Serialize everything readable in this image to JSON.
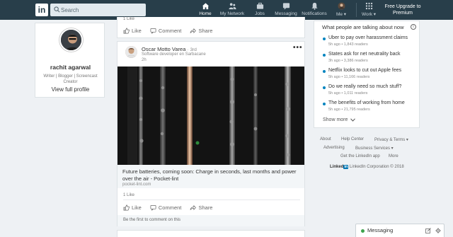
{
  "nav": {
    "logo": "in",
    "search_placeholder": "Search",
    "items": [
      {
        "label": "Home",
        "icon": "home-icon"
      },
      {
        "label": "My Network",
        "icon": "network-icon"
      },
      {
        "label": "Jobs",
        "icon": "briefcase-icon"
      },
      {
        "label": "Messaging",
        "icon": "chat-icon"
      },
      {
        "label": "Notifications",
        "icon": "bell-icon"
      },
      {
        "label": "Me ▾",
        "icon": "avatar"
      },
      {
        "label": "Work ▾",
        "icon": "grid-icon"
      }
    ],
    "premium": "Free Upgrade to Premium"
  },
  "profile": {
    "name": "rachit agarwal",
    "headline": "Writer | Blogger | Screencast Creator",
    "view_profile": "View full profile"
  },
  "feed_top": {
    "count": "1 Like",
    "actions": [
      "Like",
      "Comment",
      "Share"
    ]
  },
  "post": {
    "author": "Oscar Motto Varea",
    "degree": "· 3rd",
    "author_title": "Software developer en Sarbacane",
    "time": "2h",
    "more": "•••",
    "link_title": "Future batteries, coming soon: Charge in seconds, last months and power over the air - Pocket-lint",
    "link_source": "pocket-lint.com",
    "likes": "1 Like",
    "actions": [
      "Like",
      "Comment",
      "Share"
    ],
    "comment_prompt": "Be the first to comment on this"
  },
  "news": {
    "title": "What people are talking about now",
    "info": "i",
    "items": [
      {
        "headline": "Uber to pay over harassment claims",
        "meta": "5h ago • 1,843 readers"
      },
      {
        "headline": "States ask for net neutrality back",
        "meta": "3h ago • 3,386 readers"
      },
      {
        "headline": "Netflix looks to cut out Apple fees",
        "meta": "5h ago • 11,166 readers"
      },
      {
        "headline": "Do we really need so much stuff?",
        "meta": "5h ago • 1,011 readers"
      },
      {
        "headline": "The benefits of working from home",
        "meta": "5h ago • 21,795 readers"
      }
    ],
    "show_more": "Show more"
  },
  "footer": {
    "links": [
      "About",
      "Help Center",
      "Privacy & Terms ▾",
      "Advertising",
      "Business Services ▾",
      "Get the LinkedIn app",
      "More"
    ],
    "brand": "Linked",
    "brand_in": "in",
    "copyright": "LinkedIn Corporation © 2018"
  },
  "messaging": {
    "label": "Messaging"
  }
}
